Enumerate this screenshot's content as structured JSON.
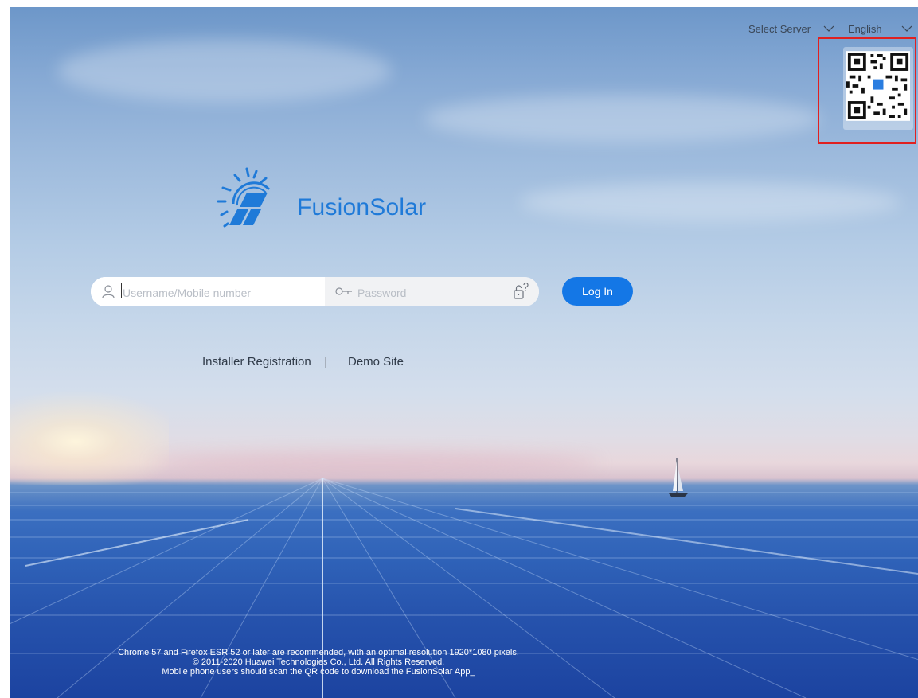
{
  "header": {
    "server_select": {
      "label": "Select Server",
      "icon": "chevron-down-icon"
    },
    "language_select": {
      "label": "English",
      "icon": "chevron-down-icon"
    }
  },
  "qr": {
    "icon": "qr-code-icon",
    "highlighted": true,
    "highlight_color": "#e02020"
  },
  "brand": {
    "name": "FusionSolar",
    "icon": "fusionsolar-logo",
    "color": "#1f7ad8"
  },
  "login": {
    "username_placeholder": "Username/Mobile number",
    "password_placeholder": "Password",
    "user_icon": "user-icon",
    "key_icon": "key-icon",
    "lock_icon": "lock-question-icon",
    "login_label": "Log In",
    "button_color": "#1477e6"
  },
  "links": {
    "installer_registration": "Installer Registration",
    "demo_site": "Demo Site"
  },
  "footer": {
    "line1": "Chrome 57 and Firefox ESR 52 or later are recommended, with an optimal resolution 1920*1080 pixels.",
    "line2": "© 2011-2020 Huawei Technologies Co., Ltd. All Rights Reserved.",
    "line3": "Mobile phone users should scan the QR code to download the FusionSolar App_"
  }
}
